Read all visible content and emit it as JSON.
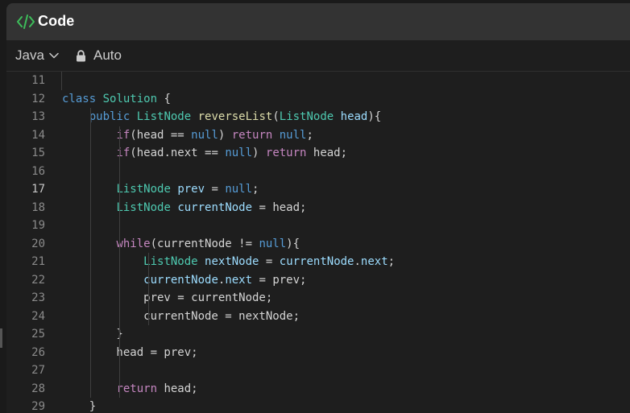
{
  "header": {
    "title": "Code"
  },
  "toolbar": {
    "language": "Java",
    "mode": "Auto"
  },
  "lines": [
    {
      "n": "11",
      "tokens": []
    },
    {
      "n": "12",
      "tokens": [
        [
          "kw",
          "class"
        ],
        [
          "plain",
          " "
        ],
        [
          "type",
          "Solution"
        ],
        [
          "plain",
          " {"
        ]
      ]
    },
    {
      "n": "13",
      "tokens": [
        [
          "plain",
          "    "
        ],
        [
          "kw",
          "public"
        ],
        [
          "plain",
          " "
        ],
        [
          "type",
          "ListNode"
        ],
        [
          "plain",
          " "
        ],
        [
          "fn",
          "reverseList"
        ],
        [
          "plain",
          "("
        ],
        [
          "type",
          "ListNode"
        ],
        [
          "plain",
          " "
        ],
        [
          "var",
          "head"
        ],
        [
          "plain",
          "){"
        ]
      ]
    },
    {
      "n": "14",
      "tokens": [
        [
          "plain",
          "        "
        ],
        [
          "ctl",
          "if"
        ],
        [
          "plain",
          "(head == "
        ],
        [
          "kw",
          "null"
        ],
        [
          "plain",
          ") "
        ],
        [
          "ctl",
          "return"
        ],
        [
          "plain",
          " "
        ],
        [
          "kw",
          "null"
        ],
        [
          "plain",
          ";"
        ]
      ]
    },
    {
      "n": "15",
      "tokens": [
        [
          "plain",
          "        "
        ],
        [
          "ctl",
          "if"
        ],
        [
          "plain",
          "(head.next == "
        ],
        [
          "kw",
          "null"
        ],
        [
          "plain",
          ") "
        ],
        [
          "ctl",
          "return"
        ],
        [
          "plain",
          " head;"
        ]
      ]
    },
    {
      "n": "16",
      "tokens": []
    },
    {
      "n": "17",
      "tokens": [
        [
          "plain",
          "        "
        ],
        [
          "type",
          "ListNode"
        ],
        [
          "plain",
          " "
        ],
        [
          "var",
          "prev"
        ],
        [
          "plain",
          " = "
        ],
        [
          "kw",
          "null"
        ],
        [
          "plain",
          ";"
        ]
      ]
    },
    {
      "n": "18",
      "tokens": [
        [
          "plain",
          "        "
        ],
        [
          "type",
          "ListNode"
        ],
        [
          "plain",
          " "
        ],
        [
          "var",
          "currentNode"
        ],
        [
          "plain",
          " = head;"
        ]
      ]
    },
    {
      "n": "19",
      "tokens": []
    },
    {
      "n": "20",
      "tokens": [
        [
          "plain",
          "        "
        ],
        [
          "ctl",
          "while"
        ],
        [
          "plain",
          "(currentNode != "
        ],
        [
          "kw",
          "null"
        ],
        [
          "plain",
          "){"
        ]
      ]
    },
    {
      "n": "21",
      "tokens": [
        [
          "plain",
          "            "
        ],
        [
          "type",
          "ListNode"
        ],
        [
          "plain",
          " "
        ],
        [
          "var",
          "nextNode"
        ],
        [
          "plain",
          " = "
        ],
        [
          "var",
          "currentNode"
        ],
        [
          "plain",
          "."
        ],
        [
          "var",
          "next"
        ],
        [
          "plain",
          ";"
        ]
      ]
    },
    {
      "n": "22",
      "tokens": [
        [
          "plain",
          "            "
        ],
        [
          "var",
          "currentNode"
        ],
        [
          "plain",
          "."
        ],
        [
          "var",
          "next"
        ],
        [
          "plain",
          " = prev;"
        ]
      ]
    },
    {
      "n": "23",
      "tokens": [
        [
          "plain",
          "            prev = currentNode;"
        ]
      ]
    },
    {
      "n": "24",
      "tokens": [
        [
          "plain",
          "            currentNode = nextNode;"
        ]
      ]
    },
    {
      "n": "25",
      "tokens": [
        [
          "plain",
          "        }"
        ]
      ]
    },
    {
      "n": "26",
      "tokens": [
        [
          "plain",
          "        head = prev;"
        ]
      ]
    },
    {
      "n": "27",
      "tokens": []
    },
    {
      "n": "28",
      "tokens": [
        [
          "plain",
          "        "
        ],
        [
          "ctl",
          "return"
        ],
        [
          "plain",
          " head;"
        ]
      ]
    },
    {
      "n": "29",
      "tokens": [
        [
          "plain",
          "    }"
        ]
      ]
    }
  ],
  "active_line": "17"
}
